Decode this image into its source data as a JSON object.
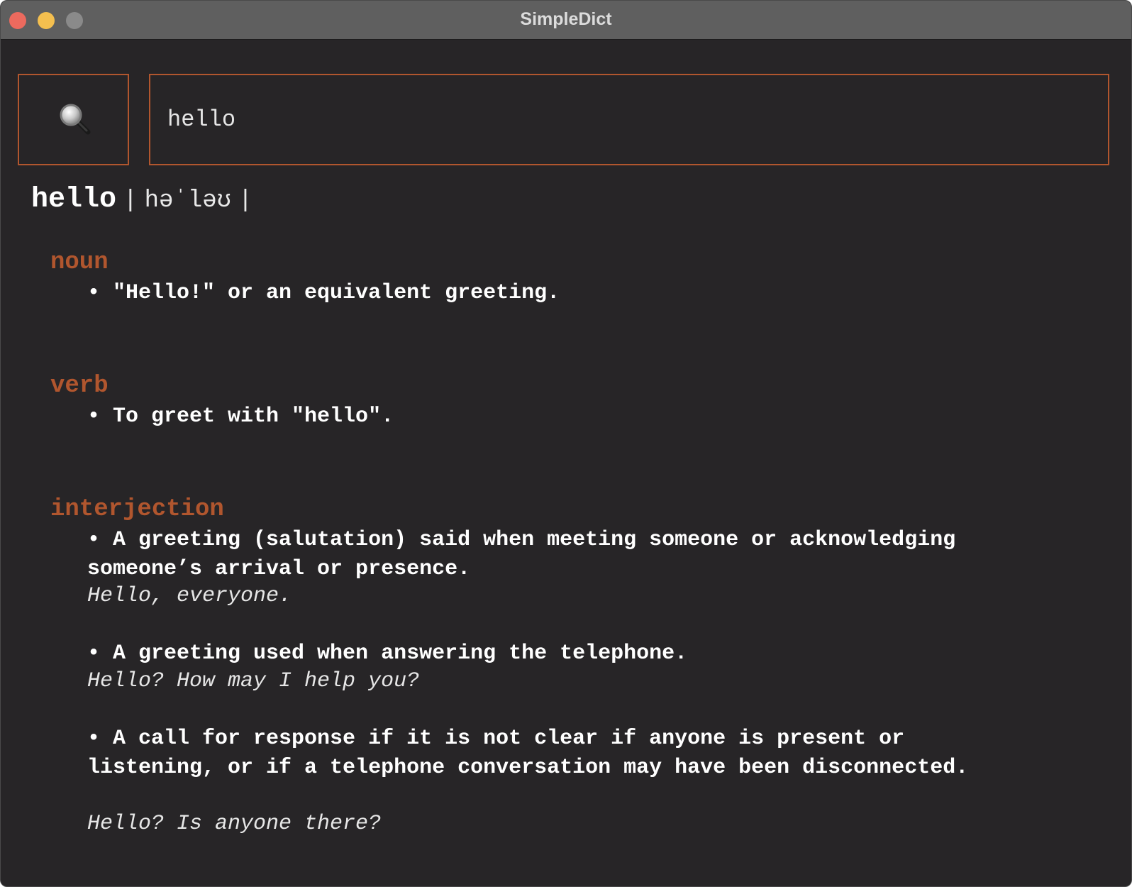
{
  "window": {
    "title": "SimpleDict"
  },
  "search": {
    "value": "hello",
    "button_icon": "magnifying-glass-icon"
  },
  "entry": {
    "word": "hello",
    "sep_left": "|",
    "pronunciation": "həˈləʊ",
    "sep_right": "|",
    "noun": {
      "label": "noun",
      "defs": [
        "• \"Hello!\" or an equivalent greeting."
      ]
    },
    "verb": {
      "label": "verb",
      "defs": [
        "• To greet with \"hello\"."
      ]
    },
    "interjection": {
      "label": "interjection",
      "defs": [
        {
          "text": "• A greeting (salutation) said when meeting someone or acknowledging someone’s arrival or presence.",
          "example": "Hello, everyone."
        },
        {
          "text": "• A greeting used when answering the telephone.",
          "example": "Hello? How may I help you?"
        },
        {
          "text": "• A call for response if it is not clear if anyone is present or listening, or if a telephone conversation may have been disconnected.",
          "example": "Hello? Is anyone there?"
        }
      ]
    }
  },
  "colors": {
    "accent": "#b1562e",
    "background": "#272527",
    "titlebar": "#5f5f5f"
  }
}
